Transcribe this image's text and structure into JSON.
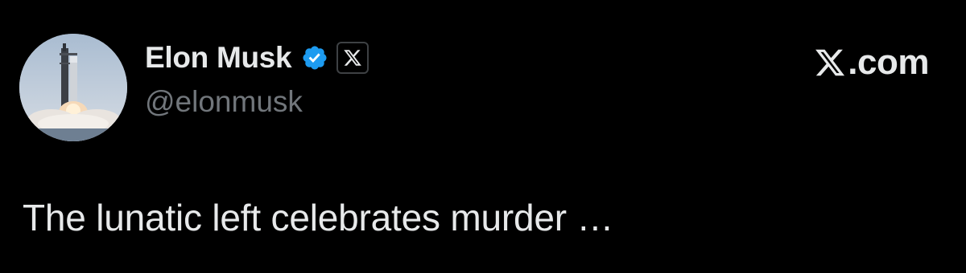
{
  "author": {
    "display_name": "Elon Musk",
    "handle": "@elonmusk",
    "verified": true,
    "verified_icon": "verified-badge-icon",
    "affiliate_icon": "x-logo-icon",
    "avatar_icon": "rocket-launch-avatar"
  },
  "brand": {
    "icon": "x-logo-icon",
    "domain": ".com"
  },
  "tweet": {
    "text": "The lunatic left celebrates murder …"
  },
  "colors": {
    "background": "#000000",
    "primary_text": "#e7e9ea",
    "secondary_text": "#71767b",
    "verified_blue": "#1d9bf0"
  }
}
